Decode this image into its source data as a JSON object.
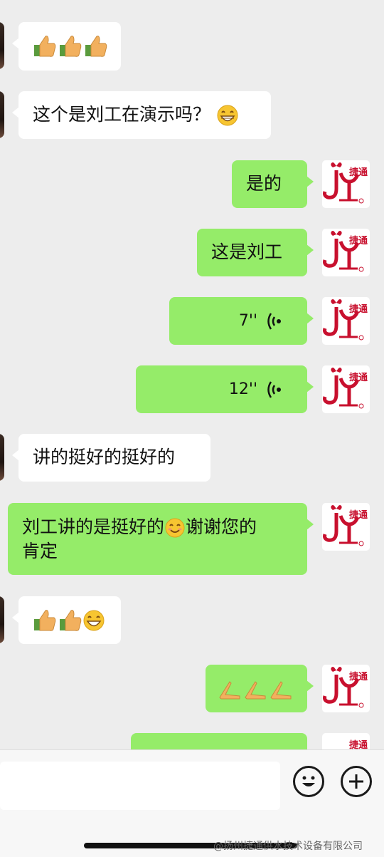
{
  "messages": [
    {
      "side": "left",
      "text": "",
      "emojis": [
        "thumbs-up",
        "thumbs-up",
        "thumbs-up"
      ]
    },
    {
      "side": "left",
      "text": "这个是刘工在演示吗？",
      "emojis": [
        "grin"
      ]
    },
    {
      "side": "right",
      "text": "是的"
    },
    {
      "side": "right",
      "text": "这是刘工"
    },
    {
      "side": "right",
      "voice_duration": "7''"
    },
    {
      "side": "right",
      "voice_duration": "12''"
    },
    {
      "side": "left",
      "text": "讲的挺好的挺好的"
    },
    {
      "side": "right",
      "text_a": "刘工讲的是挺好的",
      "text_b": "谢谢您的",
      "text_c": "肯定",
      "emojis": [
        "smile"
      ]
    },
    {
      "side": "left",
      "text": "",
      "emojis": [
        "thumbs-up",
        "thumbs-up",
        "grin"
      ]
    },
    {
      "side": "right",
      "text": "",
      "emojis": [
        "pray",
        "pray",
        "pray"
      ]
    }
  ],
  "avatar": {
    "logo_text": "捷通",
    "icon": "company-logo-icon"
  },
  "input_bar": {
    "placeholder": "",
    "emoji_icon": "emoji-icon",
    "plus_icon": "plus-icon"
  },
  "watermark": "@扬州捷通供水技术设备有限公司",
  "colors": {
    "my_bubble": "#95ec69",
    "their_bubble": "#ffffff",
    "background": "#ededed",
    "logo_red": "#c8102e"
  }
}
